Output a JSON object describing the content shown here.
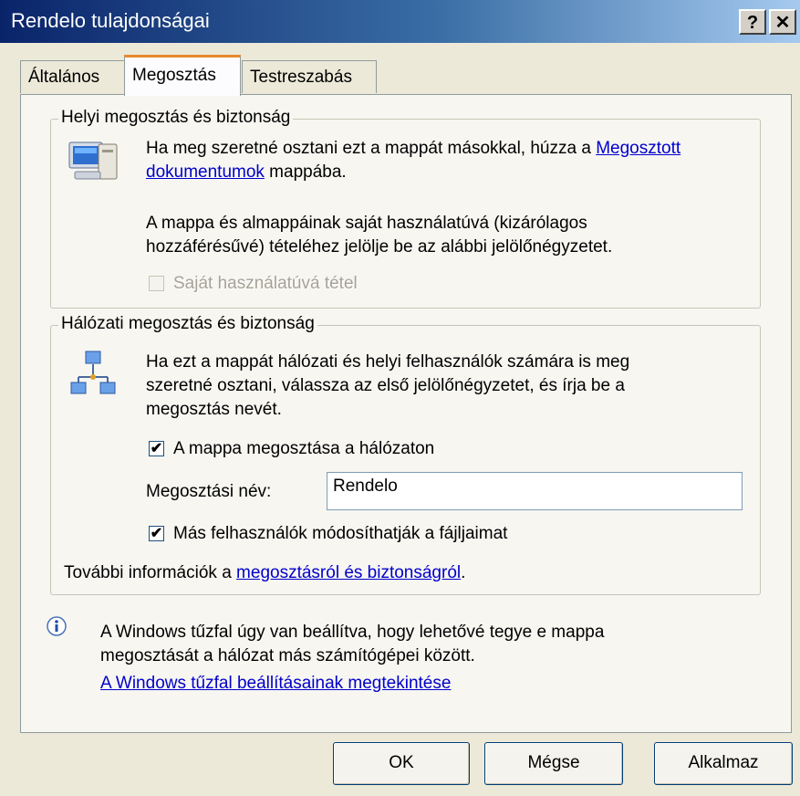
{
  "window": {
    "title": "Rendelo tulajdonságai",
    "help_button": "?",
    "close_button": "✕"
  },
  "tabs": [
    {
      "label": "Általános"
    },
    {
      "label": "Megosztás"
    },
    {
      "label": "Testreszabás"
    }
  ],
  "local_group": {
    "legend": "Helyi megosztás és biztonság",
    "text1_pre": "Ha meg szeretné osztani ezt a mappát másokkal, húzza a ",
    "text1_link_line1": "Megosztott",
    "text1_link_line2": "dokumentumok",
    "text1_post": " mappába.",
    "text2_line1": "A mappa és almappáinak saját használatúvá (kizárólagos",
    "text2_line2": "hozzáférésűvé) tételéhez jelölje be az alábbi jelölőnégyzetet.",
    "private_checkbox_label": "Saját használatúvá tétel"
  },
  "network_group": {
    "legend": "Hálózati megosztás és biztonság",
    "text_line1": "Ha ezt a mappát hálózati és helyi felhasználók számára is meg",
    "text_line2": "szeretné osztani, válassza az első jelölőnégyzetet, és írja be a",
    "text_line3": "megosztás nevét.",
    "share_checkbox_label": "A mappa megosztása a hálózaton",
    "share_name_label": "Megosztási név:",
    "share_name_value": "Rendelo",
    "modify_checkbox_label": "Más felhasználók módosíthatják a fájljaimat",
    "more_info_pre": "További információk a ",
    "more_info_link": "megosztásról és biztonságról",
    "more_info_post": "."
  },
  "firewall": {
    "info_line1": "A Windows tűzfal úgy van beállítva, hogy lehetővé tegye e mappa",
    "info_line2": "megosztását a hálózat más számítógépei között.",
    "link": "A Windows tűzfal beállításainak megtekintése"
  },
  "buttons": {
    "ok": "OK",
    "cancel": "Mégse",
    "apply": "Alkalmaz"
  },
  "checkmark": "✔",
  "icons": [
    "computer-icon",
    "network-icon",
    "info-icon",
    "help-icon",
    "close-icon"
  ]
}
